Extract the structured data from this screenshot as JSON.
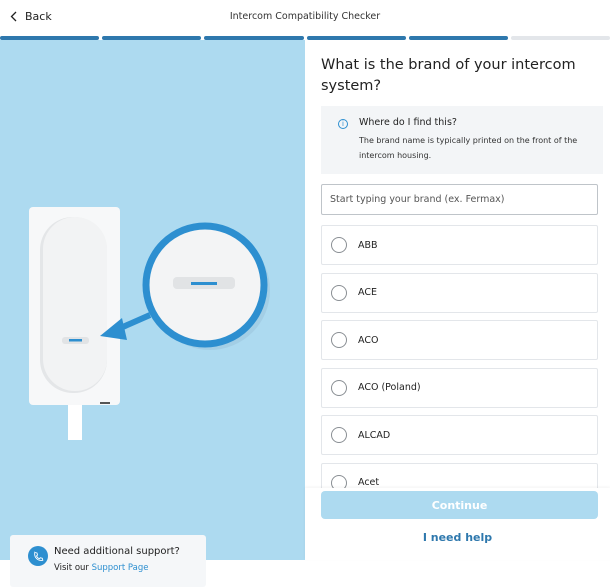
{
  "header": {
    "back_label": "Back",
    "title": "Intercom Compatibility Checker"
  },
  "progress": {
    "total_steps": 6,
    "completed_steps": 5,
    "color": "#2e78ad"
  },
  "question": "What is the brand of your intercom system?",
  "info": {
    "icon": "info-icon",
    "title": "Where do I find this?",
    "text": "The brand name is typically printed on the front of the intercom housing."
  },
  "search": {
    "placeholder": "Start typing your brand (ex. Fermax)",
    "value": ""
  },
  "brands": [
    "ABB",
    "ACE",
    "ACO",
    "ACO (Poland)",
    "ALCAD",
    "Acet"
  ],
  "footer": {
    "continue_label": "Continue",
    "help_label": "I need help"
  },
  "support": {
    "icon": "phone-icon",
    "title": "Need additional support?",
    "prefix": "Visit our",
    "link": "Support Page"
  },
  "colors": {
    "panel": "#addaf0",
    "accent": "#2d8fd0"
  }
}
